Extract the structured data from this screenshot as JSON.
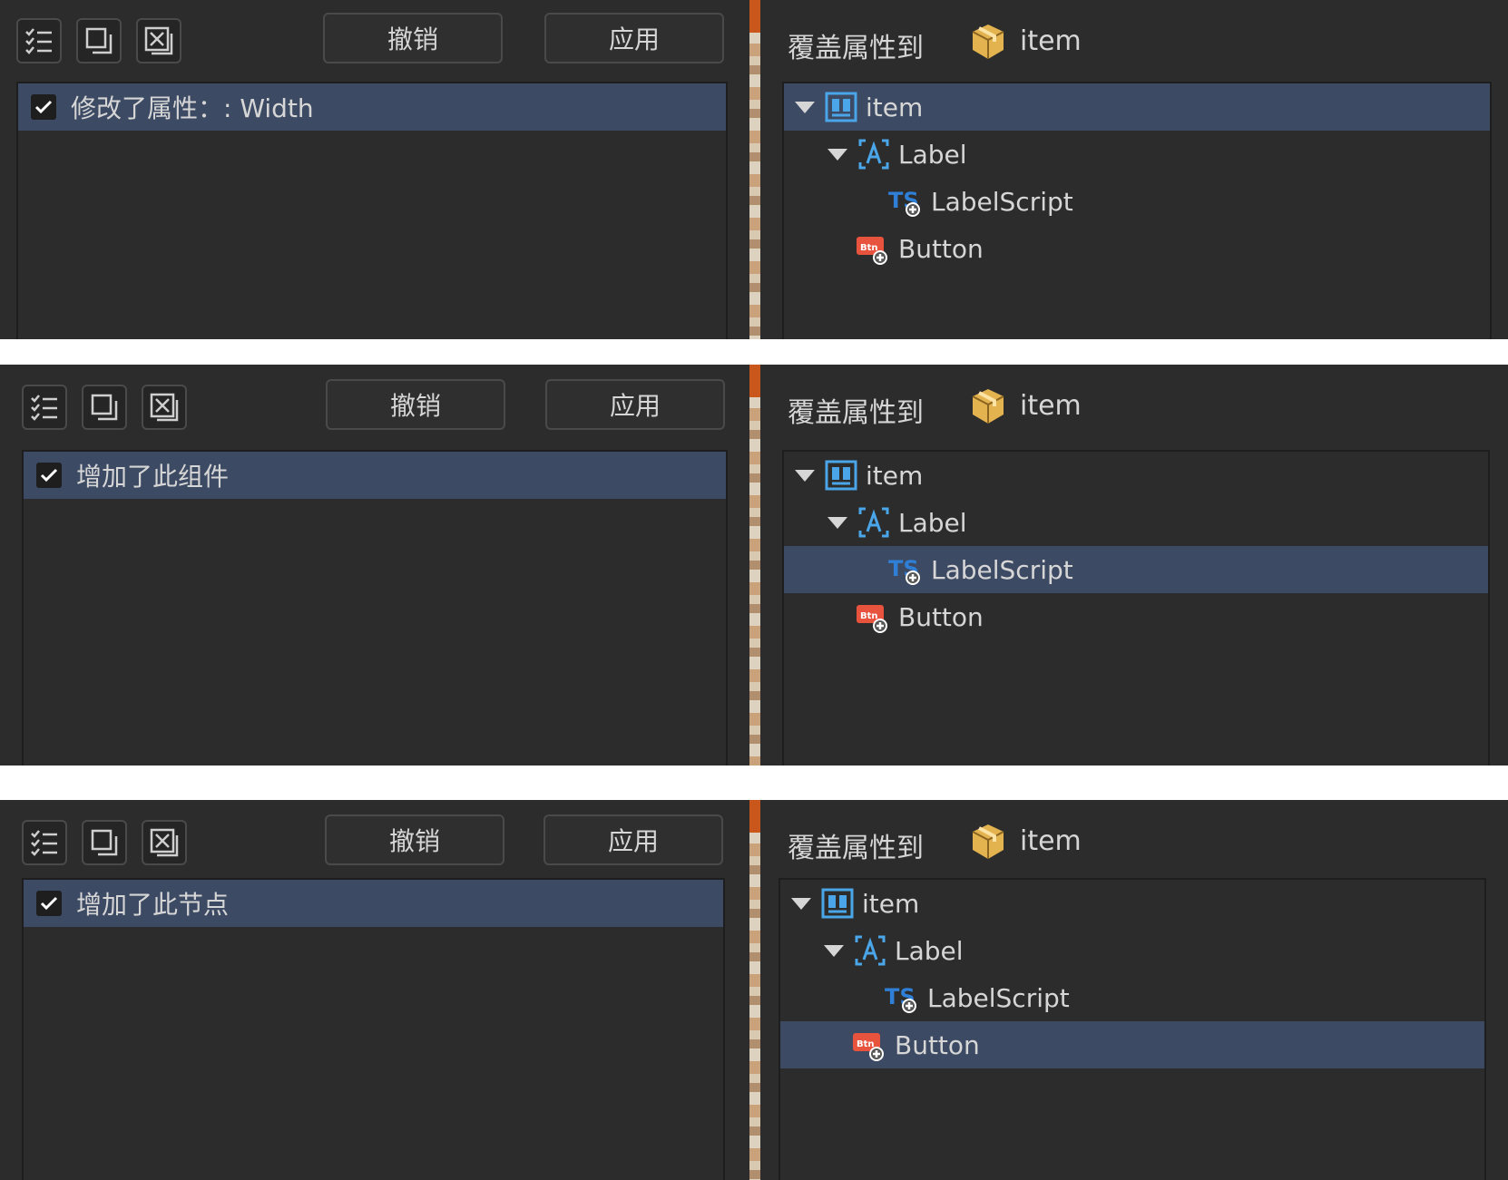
{
  "toolbar": {
    "cancel_label": "撤销",
    "apply_label": "应用",
    "icons": [
      "checklist-icon",
      "copy-icon",
      "close-icon"
    ]
  },
  "override": {
    "label": "覆盖属性到",
    "target": "item",
    "target_icon": "prefab-box-icon"
  },
  "tree": {
    "nodes": [
      {
        "label": "item",
        "icon": "node-layout-icon"
      },
      {
        "label": "Label",
        "icon": "label-component-icon"
      },
      {
        "label": "LabelScript",
        "icon": "typescript-added-icon"
      },
      {
        "label": "Button",
        "icon": "button-added-icon"
      }
    ]
  },
  "panels": [
    {
      "change": "修改了属性：: Width",
      "selected_node": "item"
    },
    {
      "change": "增加了此组件",
      "selected_node": "LabelScript"
    },
    {
      "change": "增加了此节点",
      "selected_node": "Button"
    }
  ],
  "colors": {
    "background": "#2c2c2c",
    "selection": "#3c4a63",
    "accent_orange": "#c9561b",
    "icon_blue": "#4aa6e8",
    "ts_blue": "#2f7fd6",
    "btn_red": "#e8533e"
  }
}
